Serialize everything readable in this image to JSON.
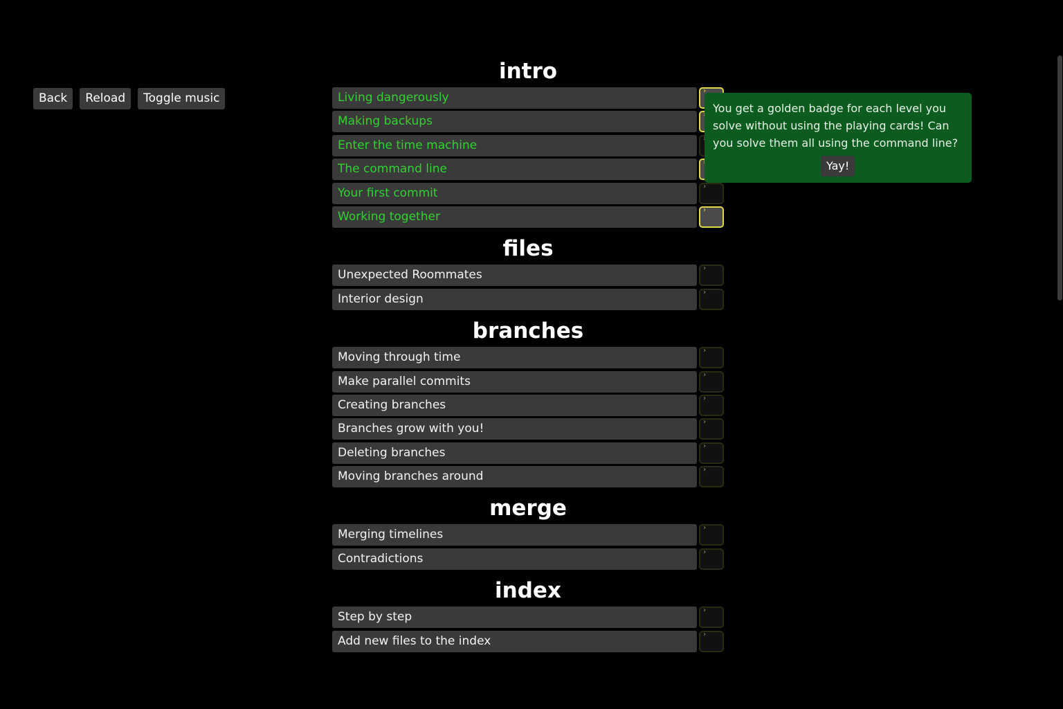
{
  "toolbar": {
    "back_label": "Back",
    "reload_label": "Reload",
    "toggle_music_label": "Toggle music"
  },
  "chapters": [
    {
      "title": "intro",
      "levels": [
        {
          "label": "Living dangerously",
          "solved": true,
          "golden_badge": true
        },
        {
          "label": "Making backups",
          "solved": true,
          "golden_badge": true
        },
        {
          "label": "Enter the time machine",
          "solved": true,
          "golden_badge": false
        },
        {
          "label": "The command line",
          "solved": true,
          "golden_badge": true
        },
        {
          "label": "Your first commit",
          "solved": true,
          "golden_badge": false
        },
        {
          "label": "Working together",
          "solved": true,
          "golden_badge": true
        }
      ]
    },
    {
      "title": "files",
      "levels": [
        {
          "label": "Unexpected Roommates",
          "solved": false,
          "golden_badge": false
        },
        {
          "label": "Interior design",
          "solved": false,
          "golden_badge": false
        }
      ]
    },
    {
      "title": "branches",
      "levels": [
        {
          "label": "Moving through time",
          "solved": false,
          "golden_badge": false
        },
        {
          "label": "Make parallel commits",
          "solved": false,
          "golden_badge": false
        },
        {
          "label": "Creating branches",
          "solved": false,
          "golden_badge": false
        },
        {
          "label": "Branches grow with you!",
          "solved": false,
          "golden_badge": false
        },
        {
          "label": "Deleting branches",
          "solved": false,
          "golden_badge": false
        },
        {
          "label": "Moving branches around",
          "solved": false,
          "golden_badge": false
        }
      ]
    },
    {
      "title": "merge",
      "levels": [
        {
          "label": "Merging timelines",
          "solved": false,
          "golden_badge": false
        },
        {
          "label": "Contradictions",
          "solved": false,
          "golden_badge": false
        }
      ]
    },
    {
      "title": "index",
      "levels": [
        {
          "label": "Step by step",
          "solved": false,
          "golden_badge": false
        },
        {
          "label": "Add new files to the index",
          "solved": false,
          "golden_badge": false
        },
        {
          "label": "",
          "solved": false,
          "golden_badge": false
        }
      ]
    }
  ],
  "tooltip": {
    "text": "You get a golden badge for each level you solve without using the playing cards! Can you solve them all using the command line?",
    "button_label": "Yay!"
  },
  "colors": {
    "background": "#000000",
    "button_bg": "#3a3a3a",
    "solved_text": "#2fd32f",
    "unsolved_text": "#f2f2f2",
    "tooltip_bg": "#0b5c1e",
    "golden_border": "#dcd84a"
  },
  "icons": {
    "badge": "terminal-badge-icon"
  }
}
